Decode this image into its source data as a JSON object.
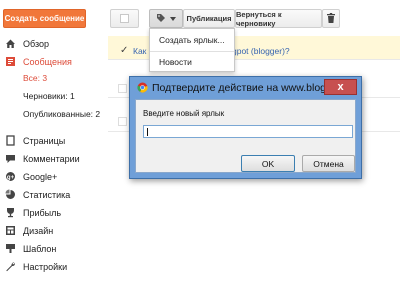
{
  "sidebar": {
    "new_post_label": "Создать сообщение",
    "items": [
      {
        "label": "Обзор",
        "icon": "home-icon"
      },
      {
        "label": "Сообщения",
        "icon": "posts-icon"
      },
      {
        "label": "Страницы",
        "icon": "pages-icon"
      },
      {
        "label": "Комментарии",
        "icon": "comments-icon"
      },
      {
        "label": "Google+",
        "icon": "google-plus-icon"
      },
      {
        "label": "Статистика",
        "icon": "stats-icon"
      },
      {
        "label": "Прибыль",
        "icon": "earnings-icon"
      },
      {
        "label": "Дизайн",
        "icon": "layout-icon"
      },
      {
        "label": "Шаблон",
        "icon": "template-icon"
      },
      {
        "label": "Настройки",
        "icon": "settings-icon"
      }
    ],
    "sub_items": [
      {
        "label": "Все: 3"
      },
      {
        "label": "Черновики: 1"
      },
      {
        "label": "Опубликованные: 2"
      }
    ],
    "accent": "#dd4b39"
  },
  "toolbar": {
    "label_dropdown_icon": "tag-icon",
    "publish_label": "Публикация",
    "revert_label": "Вернуться к черновику",
    "delete_icon": "trash-icon"
  },
  "label_menu": {
    "create_label": "Создать ярлык...",
    "news_label": "Новости"
  },
  "posts": [
    {
      "title_start": "Как",
      "title_end": "gpot (blogger)?"
    }
  ],
  "dialog": {
    "title": "Подтвердите действие на www.blogger.c...",
    "prompt": "Введите новый ярлык",
    "input_value": "",
    "ok_label": "OK",
    "cancel_label": "Отмена",
    "close_glyph": "x"
  }
}
